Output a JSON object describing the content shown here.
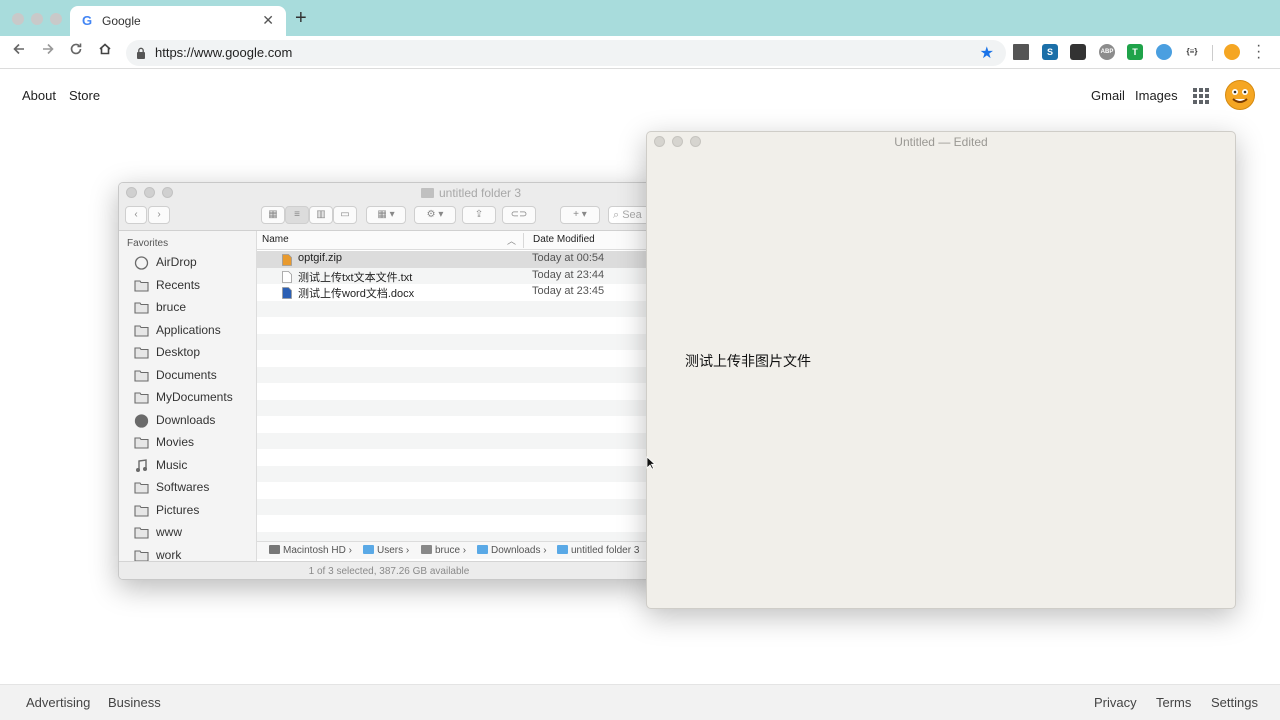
{
  "browser": {
    "tab_title": "Google",
    "tab_favicon": "G",
    "tab_close": "✕",
    "new_tab": "+",
    "url": "https://www.google.com",
    "extensions": [
      "qr-icon",
      "snagit-icon",
      "image-icon",
      "abp-icon",
      "ghostery-icon",
      "vpn-icon",
      "json-icon",
      "emoji-icon"
    ],
    "ext_labels": {
      "abp": "ABP",
      "json": "{≡}"
    }
  },
  "google": {
    "about": "About",
    "store": "Store",
    "gmail": "Gmail",
    "images": "Images"
  },
  "footer": {
    "advertising": "Advertising",
    "business": "Business",
    "privacy": "Privacy",
    "terms": "Terms",
    "settings": "Settings"
  },
  "finder": {
    "title": "untitled folder 3",
    "search_placeholder": "Sea",
    "sidebar_heading": "Favorites",
    "sidebar_items": [
      {
        "label": "AirDrop",
        "icon": "airdrop-icon"
      },
      {
        "label": "Recents",
        "icon": "recents-icon"
      },
      {
        "label": "bruce",
        "icon": "home-icon"
      },
      {
        "label": "Applications",
        "icon": "applications-icon"
      },
      {
        "label": "Desktop",
        "icon": "desktop-icon"
      },
      {
        "label": "Documents",
        "icon": "documents-icon"
      },
      {
        "label": "MyDocuments",
        "icon": "folder-icon"
      },
      {
        "label": "Downloads",
        "icon": "downloads-icon"
      },
      {
        "label": "Movies",
        "icon": "movies-icon"
      },
      {
        "label": "Music",
        "icon": "music-icon"
      },
      {
        "label": "Softwares",
        "icon": "folder-icon"
      },
      {
        "label": "Pictures",
        "icon": "pictures-icon"
      },
      {
        "label": "www",
        "icon": "folder-icon"
      },
      {
        "label": "work",
        "icon": "folder-icon"
      }
    ],
    "columns": {
      "name": "Name",
      "date": "Date Modified"
    },
    "files": [
      {
        "name": "optgif.zip",
        "date": "Today at 00:54",
        "icon": "zip-icon",
        "selected": true
      },
      {
        "name": "测试上传txt文本文件.txt",
        "date": "Today at 23:44",
        "icon": "txt-icon",
        "selected": false
      },
      {
        "name": "测试上传word文档.docx",
        "date": "Today at 23:45",
        "icon": "docx-icon",
        "selected": false
      }
    ],
    "path": [
      "Macintosh HD",
      "Users",
      "bruce",
      "Downloads",
      "untitled folder 3"
    ],
    "status": "1 of 3 selected, 387.26 GB available"
  },
  "textedit": {
    "title": "Untitled — Edited",
    "body": "测试上传非图片文件"
  }
}
